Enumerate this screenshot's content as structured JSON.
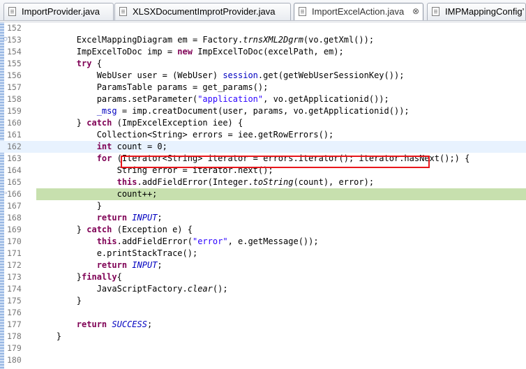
{
  "tabs": [
    {
      "label": "ImportProvider.java",
      "active": false,
      "closable": false
    },
    {
      "label": "XLSXDocumentImprotProvider.java",
      "active": false,
      "closable": false
    },
    {
      "label": "ImportExcelAction.java",
      "active": true,
      "closable": true
    },
    {
      "label": "IMPMappingConfig’",
      "active": false,
      "closable": false
    }
  ],
  "close_glyph": "⊗",
  "editor": {
    "current_line": "162",
    "debug_line": "166",
    "highlight_line": "165",
    "lines": [
      {
        "num": "152",
        "indent": 0,
        "tokens": []
      },
      {
        "num": "153",
        "indent": 2,
        "tokens": [
          [
            "t",
            "ExcelMappingDiagram em = Factory."
          ],
          [
            "m",
            "trnsXML2Dgrm"
          ],
          [
            "t",
            "(vo.getXml());"
          ]
        ],
        "marker": "search-marker-icon"
      },
      {
        "num": "154",
        "indent": 2,
        "tokens": [
          [
            "t",
            "ImpExcelToDoc imp = "
          ],
          [
            "k",
            "new"
          ],
          [
            "t",
            " ImpExcelToDoc(excelPath, em);"
          ]
        ]
      },
      {
        "num": "155",
        "indent": 2,
        "tokens": [
          [
            "k",
            "try"
          ],
          [
            "t",
            " {"
          ]
        ]
      },
      {
        "num": "156",
        "indent": 3,
        "tokens": [
          [
            "t",
            "WebUser user = (WebUser) "
          ],
          [
            "f",
            "session"
          ],
          [
            "t",
            ".get(getWebUserSessionKey());"
          ]
        ]
      },
      {
        "num": "157",
        "indent": 3,
        "tokens": [
          [
            "t",
            "ParamsTable params = get_params();"
          ]
        ]
      },
      {
        "num": "158",
        "indent": 3,
        "tokens": [
          [
            "t",
            "params.setParameter("
          ],
          [
            "s",
            "\"application\""
          ],
          [
            "t",
            ", vo.getApplicationid());"
          ]
        ]
      },
      {
        "num": "159",
        "indent": 3,
        "tokens": [
          [
            "f",
            "_msg"
          ],
          [
            "t",
            " = imp.creatDocument(user, params, vo.getApplicationid());"
          ]
        ]
      },
      {
        "num": "160",
        "indent": 2,
        "tokens": [
          [
            "t",
            "} "
          ],
          [
            "k",
            "catch"
          ],
          [
            "t",
            " (ImpExcelException iee) {"
          ]
        ]
      },
      {
        "num": "161",
        "indent": 3,
        "tokens": [
          [
            "t",
            "Collection<String> errors = iee.getRowErrors();"
          ]
        ]
      },
      {
        "num": "162",
        "indent": 3,
        "tokens": [
          [
            "k",
            "int"
          ],
          [
            "t",
            " count = 0;"
          ]
        ]
      },
      {
        "num": "163",
        "indent": 3,
        "tokens": [
          [
            "k",
            "for"
          ],
          [
            "t",
            " (Iterator<String> iterator = errors.iterator(); iterator.hasNext();) {"
          ]
        ]
      },
      {
        "num": "164",
        "indent": 4,
        "tokens": [
          [
            "t",
            "String error = iterator.next();"
          ]
        ]
      },
      {
        "num": "165",
        "indent": 4,
        "tokens": [
          [
            "k",
            "this"
          ],
          [
            "t",
            ".addFieldError(Integer."
          ],
          [
            "m",
            "toString"
          ],
          [
            "t",
            "(count), error);"
          ]
        ]
      },
      {
        "num": "166",
        "indent": 4,
        "tokens": [
          [
            "t",
            "count++;"
          ]
        ],
        "marker": "debug-arrow-icon"
      },
      {
        "num": "167",
        "indent": 3,
        "tokens": [
          [
            "t",
            "}"
          ]
        ]
      },
      {
        "num": "168",
        "indent": 3,
        "tokens": [
          [
            "k",
            "return"
          ],
          [
            "t",
            " "
          ],
          [
            "sf",
            "INPUT"
          ],
          [
            "t",
            ";"
          ]
        ]
      },
      {
        "num": "169",
        "indent": 2,
        "tokens": [
          [
            "t",
            "} "
          ],
          [
            "k",
            "catch"
          ],
          [
            "t",
            " (Exception e) {"
          ]
        ]
      },
      {
        "num": "170",
        "indent": 3,
        "tokens": [
          [
            "k",
            "this"
          ],
          [
            "t",
            ".addFieldError("
          ],
          [
            "s",
            "\"error\""
          ],
          [
            "t",
            ", e.getMessage());"
          ]
        ]
      },
      {
        "num": "171",
        "indent": 3,
        "tokens": [
          [
            "t",
            "e.printStackTrace();"
          ]
        ]
      },
      {
        "num": "172",
        "indent": 3,
        "tokens": [
          [
            "k",
            "return"
          ],
          [
            "t",
            " "
          ],
          [
            "sf",
            "INPUT"
          ],
          [
            "t",
            ";"
          ]
        ]
      },
      {
        "num": "173",
        "indent": 2,
        "tokens": [
          [
            "t",
            "}"
          ],
          [
            "k",
            "finally"
          ],
          [
            "t",
            "{"
          ]
        ]
      },
      {
        "num": "174",
        "indent": 3,
        "tokens": [
          [
            "t",
            "JavaScriptFactory."
          ],
          [
            "m",
            "clear"
          ],
          [
            "t",
            "();"
          ]
        ]
      },
      {
        "num": "175",
        "indent": 2,
        "tokens": [
          [
            "t",
            "}"
          ]
        ]
      },
      {
        "num": "176",
        "indent": 0,
        "tokens": []
      },
      {
        "num": "177",
        "indent": 2,
        "tokens": [
          [
            "k",
            "return"
          ],
          [
            "t",
            " "
          ],
          [
            "sf",
            "SUCCESS"
          ],
          [
            "t",
            ";"
          ]
        ]
      },
      {
        "num": "178",
        "indent": 1,
        "tokens": [
          [
            "t",
            "}"
          ]
        ]
      },
      {
        "num": "179",
        "indent": 0,
        "tokens": []
      },
      {
        "num": "180",
        "indent": 0,
        "tokens": []
      }
    ]
  },
  "colors": {
    "keyword": "#7f0055",
    "string": "#2a00ff",
    "field": "#0000c0",
    "current_line_bg": "#e8f2fe",
    "debug_line_bg": "#c7e0ae",
    "highlight_box": "#e8161b"
  }
}
